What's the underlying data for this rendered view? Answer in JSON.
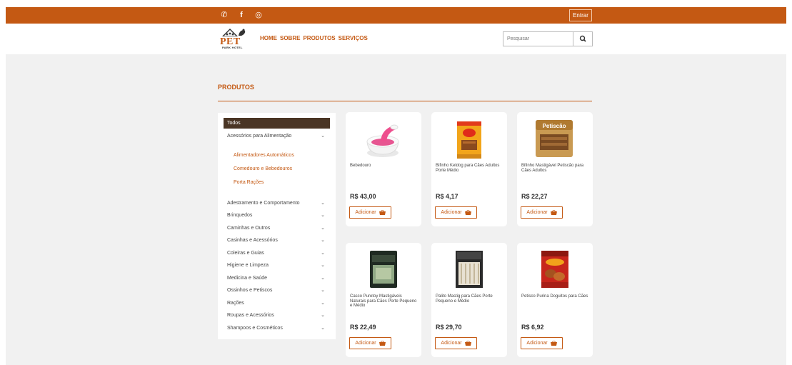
{
  "topbar": {
    "social": [
      {
        "icon": "whatsapp-icon",
        "glyph": "✆"
      },
      {
        "icon": "facebook-icon",
        "glyph": "f"
      },
      {
        "icon": "instagram-icon",
        "glyph": "◎"
      }
    ],
    "login_label": "Entrar"
  },
  "header": {
    "logo_main": "PET",
    "logo_sub": "PARK HOTEL",
    "nav": [
      "HOME",
      "SOBRE",
      "PRODUTOS",
      "SERVIÇOS"
    ],
    "search_placeholder": "Pesquisar"
  },
  "page_title": "PRODUTOS",
  "sidebar": {
    "all_label": "Todos",
    "expanded": {
      "label": "Acessórios para Alimentação",
      "items": [
        "Alimentadores Automáticos",
        "Comedouro e Bebedouros",
        "Porta Rações"
      ]
    },
    "categories": [
      "Adestramento e Comportamento",
      "Brinquedos",
      "Caminhas e Outros",
      "Casinhas e Acessórios",
      "Coleiras e Guias",
      "Higiene e Limpeza",
      "Medicina e Saúde",
      "Ossinhos e Petiscos",
      "Rações",
      "Roupas e Acessórios",
      "Shampoos e Cosméticos"
    ]
  },
  "add_label": "Adicionar",
  "products": [
    {
      "name": "Bebedouro",
      "price": "R$ 43,00",
      "image": "bowl"
    },
    {
      "name": "Bifinho Keldog para Cães Adultos Porte Médio",
      "price": "R$ 4,17",
      "image": "keldog"
    },
    {
      "name": "Bifinho Mastigável Petiscão para Cães Adultos",
      "price": "R$ 22,27",
      "image": "petiscao",
      "brand": "Petiscão"
    },
    {
      "name": "Casco Puretoy Mastigáveis Naturais para Cães Porte Pequeno e Médio",
      "price": "R$ 22,49",
      "image": "casco"
    },
    {
      "name": "Palito Mastig para Cães Porte Pequeno e Médio",
      "price": "R$ 29,70",
      "image": "palito"
    },
    {
      "name": "Petisco Purina Doguitos para Cães",
      "price": "R$ 6,92",
      "image": "doguitos"
    }
  ],
  "colors": {
    "brand": "#c45913",
    "dark": "#4a3524",
    "bg": "#f1f1f1"
  }
}
